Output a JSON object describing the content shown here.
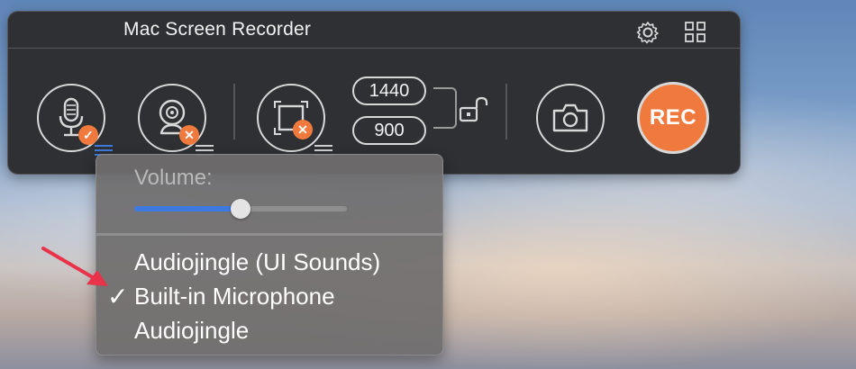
{
  "app": {
    "title": "Mac Screen Recorder"
  },
  "toolbar": {
    "mic_badge": "✓",
    "webcam_badge": "✕",
    "region_badge": "✕",
    "width_value": "1440",
    "height_value": "900",
    "rec_label": "REC"
  },
  "volume_menu": {
    "label": "Volume:",
    "volume_level": 0.5,
    "items": [
      {
        "label": "Audiojingle (UI Sounds)",
        "checked": false
      },
      {
        "label": "Built-in Microphone",
        "checked": true
      },
      {
        "label": "Audiojingle",
        "checked": false
      }
    ],
    "check_glyph": "✓"
  },
  "colors": {
    "accent_orange": "#f07a3d",
    "slider_blue": "#3d79de",
    "panel_bg": "#2f3033",
    "arrow_red": "#e8334a"
  }
}
